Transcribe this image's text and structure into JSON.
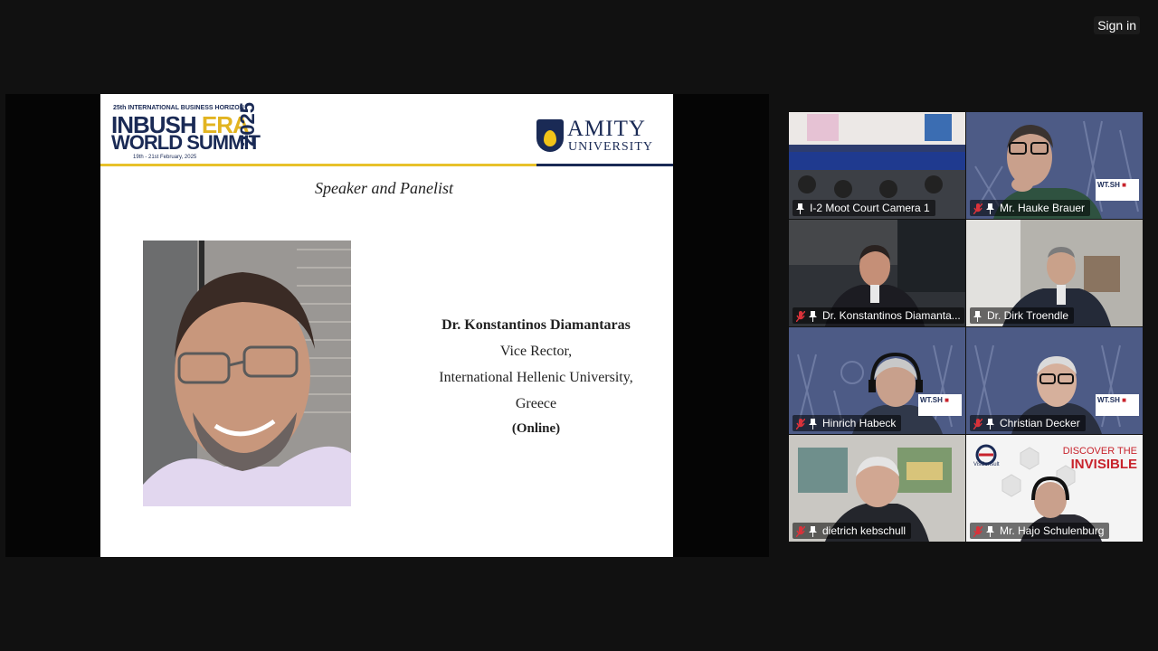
{
  "topbar": {
    "sign_in_label": "Sign in"
  },
  "slide": {
    "header_summit": {
      "top_line": "25th INTERNATIONAL BUSINESS HORIZON",
      "line1_a": "INBUSH ",
      "line1_b": "ERA",
      "line2": "WORLD SUMMIT",
      "year": "2025",
      "dates": "19th - 21st February, 2025"
    },
    "header_amity": {
      "name": "AMITY",
      "sub": "UNIVERSITY"
    },
    "title": "Speaker and Panelist",
    "speaker": {
      "name": "Dr. Konstantinos Diamantaras",
      "role": "Vice Rector,",
      "org": "International Hellenic University,",
      "country": "Greece",
      "mode": "(Online)"
    }
  },
  "gallery": {
    "tiles": [
      {
        "name": "I-2 Moot Court Camera 1",
        "muted": false
      },
      {
        "name": "Mr. Hauke Brauer",
        "muted": true
      },
      {
        "name": "Dr. Konstantinos Diamanta...",
        "muted": true
      },
      {
        "name": "Dr. Dirk Troendle",
        "muted": false
      },
      {
        "name": "Hinrich Habeck",
        "muted": true
      },
      {
        "name": "Christian Decker",
        "muted": true
      },
      {
        "name": "dietrich kebschull",
        "muted": true
      },
      {
        "name": "Mr. Hajo Schulenburg",
        "muted": true
      }
    ],
    "wtsh_logo": "WT.SH",
    "viscom": {
      "brand": "VisConsult",
      "line1": "DISCOVER THE",
      "line2": "INVISIBLE"
    }
  },
  "colors": {
    "navy": "#1a2a55",
    "gold": "#e8c12a",
    "muted_red": "#d9323a"
  }
}
